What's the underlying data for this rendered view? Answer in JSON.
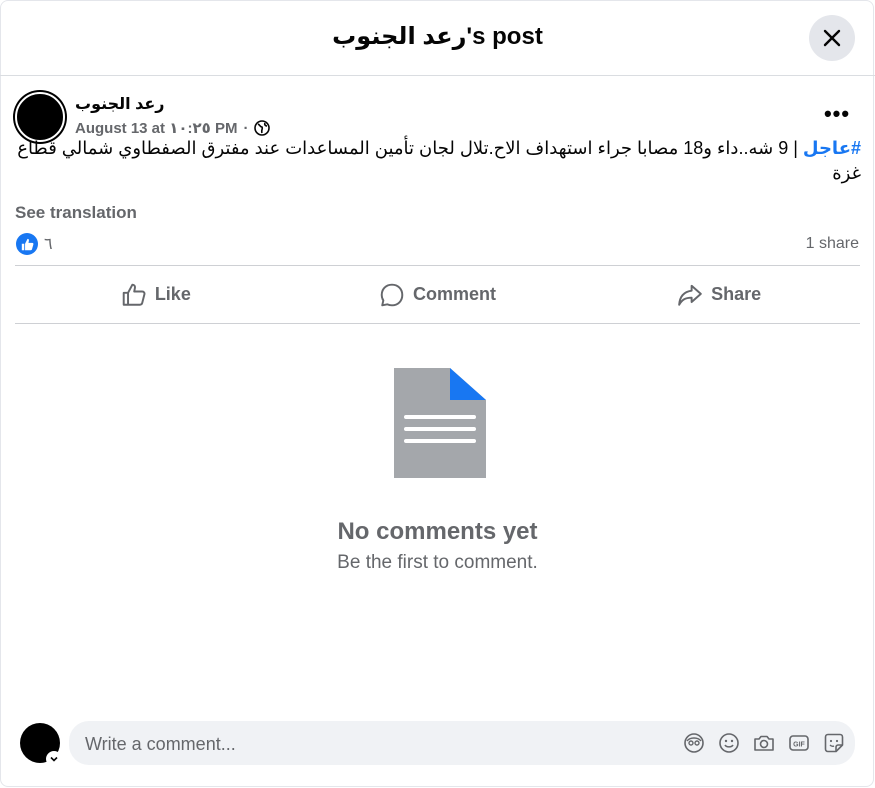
{
  "header": {
    "title": "رعد الجنوب's post"
  },
  "post": {
    "author": "رعد الجنوب",
    "timestamp": "August 13 at ١٠:٢٥ PM",
    "separator": "·",
    "hashtag": "#عاجل",
    "text": " | 9 شه..داء و18 مصابا جراء استهداف الاح.تلال لجان تأمين المساعدات عند مفترق الصفطاوي شمالي قطاع غزة",
    "see_translation": "See translation",
    "reaction_count": "٦",
    "share_count": "1 share"
  },
  "actions": {
    "like": "Like",
    "comment": "Comment",
    "share": "Share"
  },
  "empty_state": {
    "title": "No comments yet",
    "subtitle": "Be the first to comment."
  },
  "composer": {
    "placeholder": "Write a comment..."
  },
  "colors": {
    "accent": "#1877f2",
    "secondary_text": "#65676b"
  }
}
